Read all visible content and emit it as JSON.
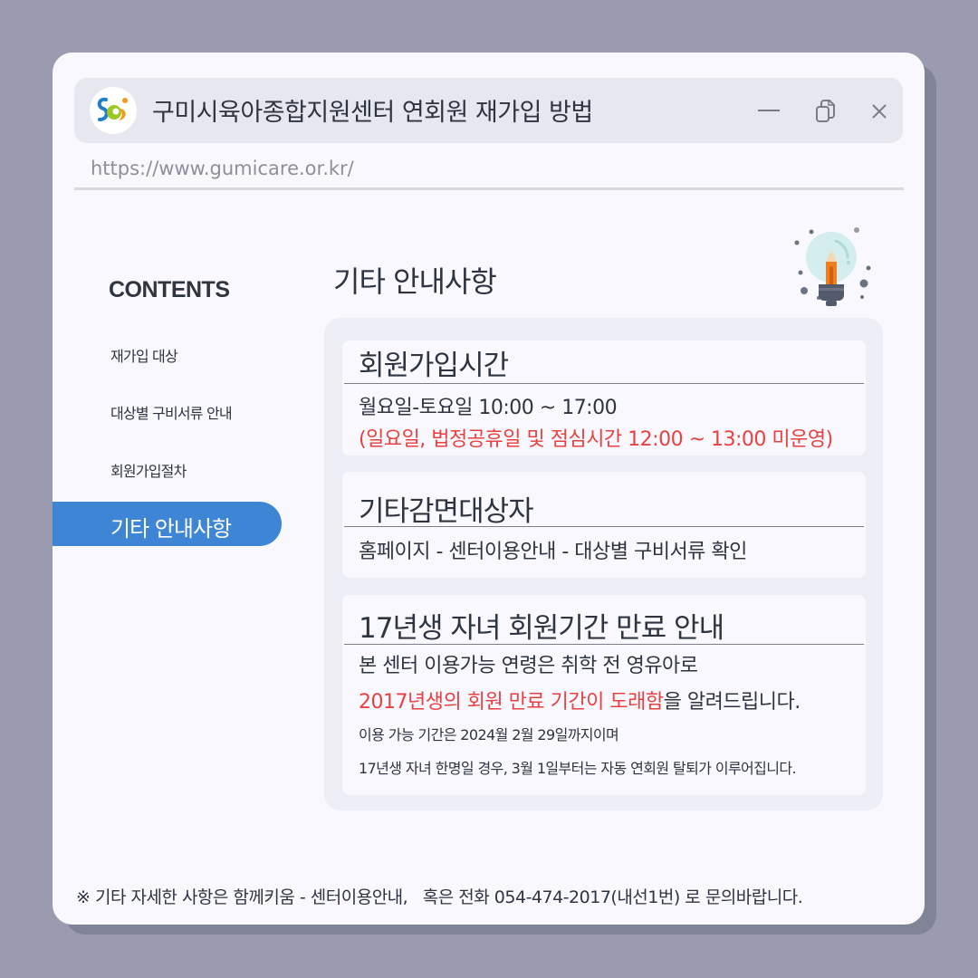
{
  "window": {
    "title": "구미시육아종합지원센터 연회원 재가입 방법",
    "url": "https://www.gumicare.or.kr/",
    "logo_icon": "sci-logo-icon",
    "controls": [
      {
        "name": "minimize",
        "icon": "minimize-icon"
      },
      {
        "name": "restore",
        "icon": "copy-icon"
      },
      {
        "name": "close",
        "icon": "close-icon"
      }
    ]
  },
  "sidebar": {
    "heading": "CONTENTS",
    "items": [
      {
        "label": "재가입 대상",
        "active": false
      },
      {
        "label": "대상별 구비서류 안내",
        "active": false
      },
      {
        "label": "회원가입절차",
        "active": false
      },
      {
        "label": "기타 안내사항",
        "active": true
      }
    ],
    "active_color": "#3e86d5"
  },
  "main": {
    "title": "기타 안내사항",
    "decor_icon": "lightbulb-pencil-icon",
    "cards": [
      {
        "title": "회원가입시간",
        "lines": [
          {
            "text": "월요일-토요일 10:00 ~ 17:00"
          },
          {
            "text": "(일요일, 법정공휴일 및 점심시간 12:00 ~ 13:00 미운영)"
          }
        ]
      },
      {
        "title": "기타감면대상자",
        "lines": [
          {
            "text": "홈페이지 - 센터이용안내 - 대상별 구비서류 확인"
          }
        ]
      },
      {
        "title": "17년생 자녀 회원기간 만료 안내",
        "lines": [
          {
            "text": "본 센터 이용가능 연령은 취학 전 영유아로"
          },
          {
            "highlight": "2017년생의 회원 만료 기간이 도래함",
            "rest": "을 알려드립니다."
          },
          {
            "text": "이용 가능 기간은 2024월 2월 29일까지이며"
          },
          {
            "text": "17년생 자녀 한명일 경우, 3월 1일부터는 자동 연회원 탈퇴가 이루어집니다."
          }
        ]
      }
    ],
    "highlight_color": "#e8413f"
  },
  "footer": {
    "text": "※ 기타 자세한 사항은 함께키움 - 센터이용안내,   혹은 전화 054-474-2017(내선1번) 로 문의바랍니다."
  }
}
